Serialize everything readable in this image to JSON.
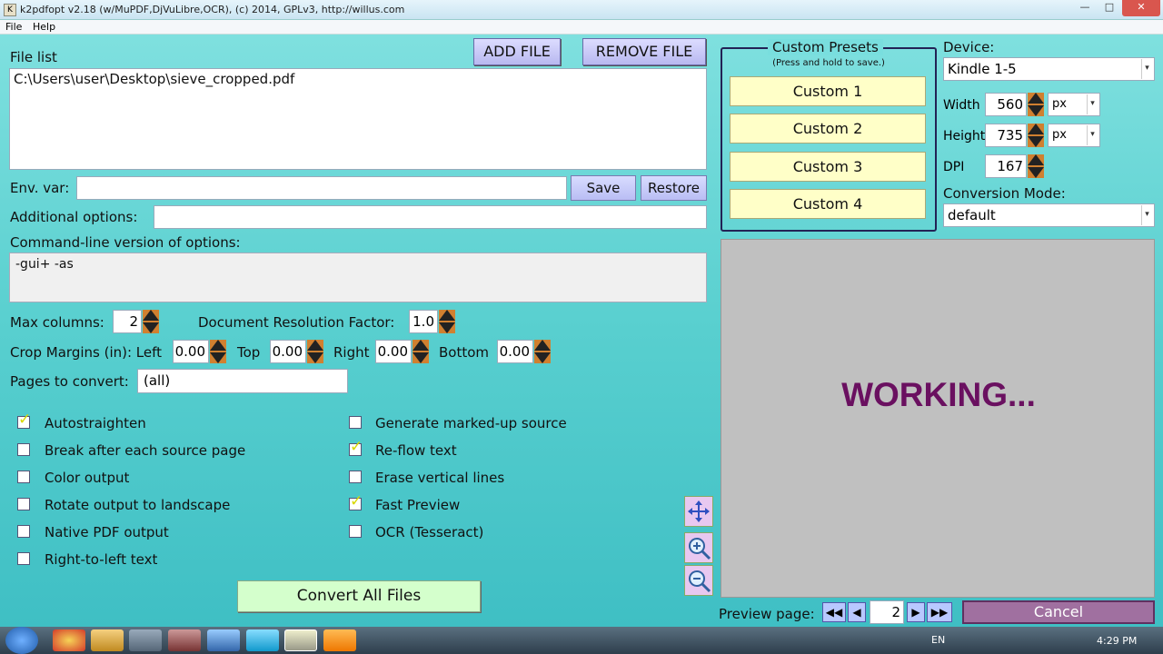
{
  "window": {
    "title": "k2pdfopt v2.18 (w/MuPDF,DjVuLibre,OCR), (c) 2014, GPLv3, http://willus.com",
    "icon": "K"
  },
  "menu": [
    "File",
    "Help"
  ],
  "file_list": {
    "label": "File list",
    "items": [
      "C:\\Users\\user\\Desktop\\sieve_cropped.pdf"
    ]
  },
  "buttons": {
    "add_file": "ADD FILE",
    "remove_file": "REMOVE FILE",
    "save": "Save",
    "restore": "Restore",
    "convert": "Convert All Files",
    "cancel": "Cancel"
  },
  "env_var": {
    "label": "Env. var:",
    "value": ""
  },
  "additional_options": {
    "label": "Additional options:",
    "value": ""
  },
  "cmdline": {
    "label": "Command-line version of options:",
    "value": "-gui+ -as"
  },
  "max_columns": {
    "label": "Max columns:",
    "value": "2"
  },
  "doc_res": {
    "label": "Document Resolution Factor:",
    "value": "1.0"
  },
  "crop": {
    "label": "Crop Margins (in): Left",
    "left": "0.00",
    "top_label": "Top",
    "top": "0.00",
    "right_label": "Right",
    "right": "0.00",
    "bottom_label": "Bottom",
    "bottom": "0.00"
  },
  "pages": {
    "label": "Pages to convert:",
    "value": "(all)"
  },
  "checkboxes_left": [
    {
      "label": "Autostraighten",
      "checked": true
    },
    {
      "label": "Break after each source page",
      "checked": false
    },
    {
      "label": "Color output",
      "checked": false
    },
    {
      "label": "Rotate output to landscape",
      "checked": false
    },
    {
      "label": "Native PDF output",
      "checked": false
    },
    {
      "label": "Right-to-left text",
      "checked": false
    }
  ],
  "checkboxes_right": [
    {
      "label": "Generate marked-up source",
      "checked": false
    },
    {
      "label": "Re-flow text",
      "checked": true
    },
    {
      "label": "Erase vertical lines",
      "checked": false
    },
    {
      "label": "Fast Preview",
      "checked": true
    },
    {
      "label": "OCR (Tesseract)",
      "checked": false
    }
  ],
  "presets": {
    "title": "Custom Presets",
    "subtitle": "(Press and hold to save.)",
    "items": [
      "Custom 1",
      "Custom 2",
      "Custom 3",
      "Custom 4"
    ]
  },
  "device": {
    "label": "Device:",
    "value": "Kindle 1-5"
  },
  "width": {
    "label": "Width",
    "value": "560",
    "unit": "px"
  },
  "height": {
    "label": "Height",
    "value": "735",
    "unit": "px"
  },
  "dpi": {
    "label": "DPI",
    "value": "167"
  },
  "mode": {
    "label": "Conversion Mode:",
    "value": "default"
  },
  "preview": {
    "status": "WORKING...",
    "page_label": "Preview page:",
    "page": "2"
  },
  "taskbar": {
    "lang": "EN",
    "time": "4:29 PM"
  },
  "icons": [
    "move-icon",
    "zoom-in-icon",
    "zoom-out-icon",
    "first-page-icon",
    "prev-page-icon",
    "next-page-icon",
    "last-page-icon"
  ]
}
